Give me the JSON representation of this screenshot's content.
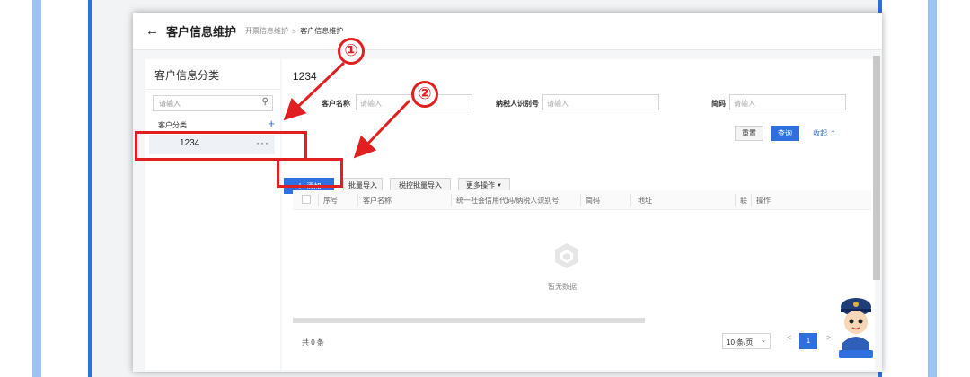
{
  "topbar": {
    "title": "客户信息维护",
    "breadcrumb": [
      "开票信息维护",
      "客户信息维护"
    ],
    "separator": ">"
  },
  "sidebar": {
    "title": "客户信息分类",
    "search_placeholder": "请输入",
    "category_label": "客户分类",
    "selected_item": "1234"
  },
  "main": {
    "title": "1234",
    "form": {
      "customer_name_label": "客户名称",
      "customer_name_placeholder": "请输入",
      "taxpayer_id_label": "纳税人识别号",
      "taxpayer_id_placeholder": "请输入",
      "short_code_label": "简码",
      "short_code_placeholder": "请输入"
    },
    "actions": {
      "reset": "重置",
      "query": "查询",
      "collapse": "收起"
    },
    "toolbar": {
      "add": "添加",
      "batch_import": "批量导入",
      "tax_control_import": "税控批量导入",
      "more_ops": "更多操作"
    },
    "table": {
      "columns": [
        "序号",
        "客户名称",
        "统一社会信用代码/纳税人识别号",
        "简码",
        "地址",
        "联",
        "操作"
      ],
      "empty_text": "暂无数据"
    },
    "footer": {
      "total": "共 0 条",
      "page_size": "10 条/页",
      "current_page": "1",
      "prev": "<",
      "next": ">"
    }
  },
  "annotations": {
    "badge_1": "①",
    "badge_2": "②"
  },
  "colors": {
    "primary": "#2f6fe0",
    "annotation_red": "#e02020",
    "side_band": "#9cc3f3"
  }
}
